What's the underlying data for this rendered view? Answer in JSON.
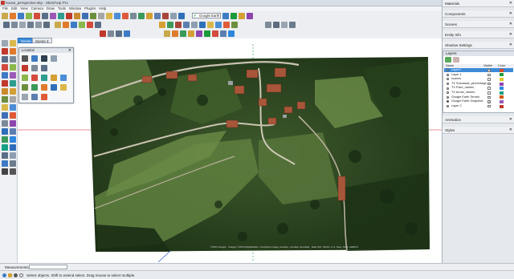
{
  "window": {
    "title": "house_perspective.skp - SketchUp Pro"
  },
  "menu": [
    "File",
    "Edit",
    "View",
    "Camera",
    "Draw",
    "Tools",
    "Window",
    "Plugins",
    "Help"
  ],
  "toolbar": {
    "location_dropdown": "Google Earth"
  },
  "scenes": [
    "Scene 1",
    "Scene 2"
  ],
  "floating_toolbar": {
    "title": "Location"
  },
  "tray": {
    "panels_top": [
      "Materials",
      "Components",
      "Scenes",
      "Entity Info",
      "Shadow Settings"
    ],
    "layers": {
      "title": "Layers",
      "columns": [
        "Name",
        "Visible",
        "Color"
      ],
      "rows": [
        {
          "name": "Layer0",
          "active": false,
          "visible": true,
          "color": "#d94a2b",
          "selected": true
        },
        {
          "name": "Layer 1",
          "active": false,
          "visible": false,
          "color": "#1f9e3a"
        },
        {
          "name": "scanns",
          "active": false,
          "visible": false,
          "color": "#e0c52a"
        },
        {
          "name": "TX Scanasse_percentage",
          "active": false,
          "visible": false,
          "color": "#8e44ad"
        },
        {
          "name": "TX Pace_names",
          "active": false,
          "visible": false,
          "color": "#2e86de"
        },
        {
          "name": "TX Arrow_names",
          "active": false,
          "visible": false,
          "color": "#16a085"
        },
        {
          "name": "Google Earth Terrain",
          "active": false,
          "visible": false,
          "color": "#d35400"
        },
        {
          "name": "Google Earth Snapshot",
          "active": true,
          "visible": true,
          "color": "#9b59b6"
        },
        {
          "name": "Layer 2",
          "active": false,
          "visible": false,
          "color": "#c0392b"
        }
      ]
    },
    "panels_bottom": [
      "Animation",
      "Styles"
    ]
  },
  "viewport": {
    "copyright": "©2013 Google · Imagery ©2013 DigitalGlobe, Cnes/Spot Image, GeoEye, Landsat, Aerodata · Data SIO, NOAA, U.S. Navy, NGA, GEBCO"
  },
  "status": {
    "measurements_label": "Measurements",
    "hint": "Select objects. Shift to extend select. Drag mouse to select multiple."
  },
  "colors": {
    "axis_red": "#cc2222",
    "axis_green": "#1a9a3a",
    "axis_blue": "#2244cc",
    "accent_blue": "#3c8ad8"
  }
}
